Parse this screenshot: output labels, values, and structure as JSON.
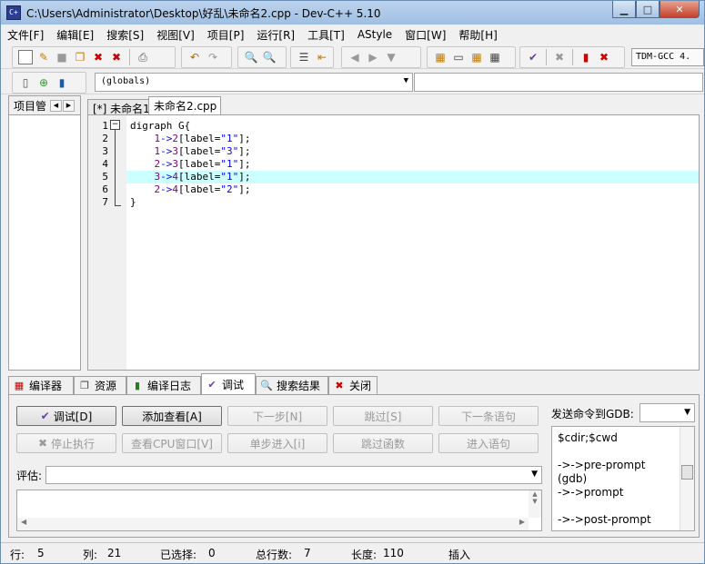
{
  "window": {
    "title": "C:\\Users\\Administrator\\Desktop\\好乱\\未命名2.cpp - Dev-C++ 5.10"
  },
  "menu": [
    "文件[F]",
    "编辑[E]",
    "搜索[S]",
    "视图[V]",
    "项目[P]",
    "运行[R]",
    "工具[T]",
    "AStyle",
    "窗口[W]",
    "帮助[H]"
  ],
  "toolbar": {
    "compiler": "TDM-GCC 4.",
    "globals_combo": "(globals)"
  },
  "left_panel": {
    "tab_label": "项目管"
  },
  "editor": {
    "tabs": [
      "[*] 未命名1",
      "未命名2.cpp"
    ],
    "line_numbers": [
      "1",
      "2",
      "3",
      "4",
      "5",
      "6",
      "7"
    ],
    "lines": [
      {
        "plain": "digraph G{"
      },
      {
        "indent": "    ",
        "a": "1",
        "op": "->",
        "b": "2",
        "label": "[label=",
        "str": "\"1\"",
        "end": "];"
      },
      {
        "indent": "    ",
        "a": "1",
        "op": "->",
        "b": "3",
        "label": "[label=",
        "str": "\"3\"",
        "end": "];"
      },
      {
        "indent": "    ",
        "a": "2",
        "op": "->",
        "b": "3",
        "label": "[label=",
        "str": "\"1\"",
        "end": "];"
      },
      {
        "indent": "    ",
        "a": "3",
        "op": "->",
        "b": "4",
        "label": "[label=",
        "str": "\"1\"",
        "end": "];"
      },
      {
        "indent": "    ",
        "a": "2",
        "op": "->",
        "b": "4",
        "label": "[label=",
        "str": "\"2\"",
        "end": "];"
      },
      {
        "plain": "}"
      }
    ],
    "highlight_color": "#ccffff"
  },
  "bottom_tabs": [
    "编译器",
    "资源",
    "编译日志",
    "调试",
    "搜索结果",
    "关闭"
  ],
  "debug": {
    "buttons_row1": [
      "调试[D]",
      "添加查看[A]",
      "下一步[N]",
      "跳过[S]",
      "下一条语句"
    ],
    "buttons_row2": [
      "停止执行",
      "查看CPU窗口[V]",
      "单步进入[i]",
      "跳过函数",
      "进入语句"
    ],
    "eval_label": "评估:",
    "gdb_label": "发送命令到GDB:",
    "gdb_output": [
      "$cdir;$cwd",
      "",
      "->->pre-prompt",
      "(gdb)",
      "->->prompt",
      "",
      "->->post-prompt"
    ]
  },
  "status": {
    "row_label": "行:",
    "row": "5",
    "col_label": "列:",
    "col": "21",
    "sel_label": "已选择:",
    "sel": "0",
    "total_label": "总行数:",
    "total": "7",
    "len_label": "长度:",
    "len": "110",
    "mode": "插入"
  }
}
